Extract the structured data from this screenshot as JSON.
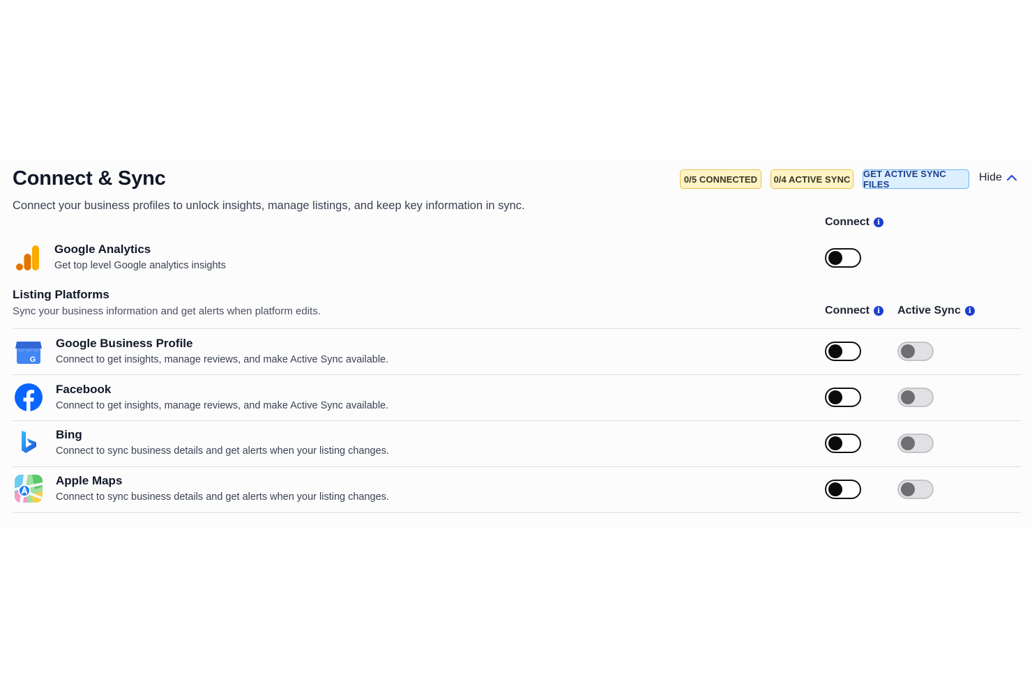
{
  "header": {
    "title": "Connect & Sync",
    "subtitle": "Connect your business profiles to unlock insights, manage listings, and keep key information in sync.",
    "badges": {
      "connected": "0/5 CONNECTED",
      "active_sync": "0/4 ACTIVE SYNC",
      "files": "GET ACTIVE SYNC FILES"
    },
    "hide_label": "Hide"
  },
  "analytics": {
    "column_connect": "Connect",
    "name": "Google Analytics",
    "description": "Get top level Google analytics insights",
    "connected": false
  },
  "listing": {
    "title": "Listing Platforms",
    "subtitle": "Sync your business information and get alerts when platform edits.",
    "column_connect": "Connect",
    "column_active_sync": "Active Sync",
    "platforms": [
      {
        "name": "Google Business Profile",
        "description": "Connect to get insights, manage reviews, and make Active Sync available.",
        "icon": "google-business-profile-icon",
        "connected": false,
        "active_sync": false
      },
      {
        "name": "Facebook",
        "description": "Connect to get insights, manage reviews, and make Active Sync available.",
        "icon": "facebook-icon",
        "connected": false,
        "active_sync": false
      },
      {
        "name": "Bing",
        "description": "Connect to sync business details and get alerts when your listing changes.",
        "icon": "bing-icon",
        "connected": false,
        "active_sync": false
      },
      {
        "name": "Apple Maps",
        "description": "Connect to sync business details and get alerts when your listing changes.",
        "icon": "apple-maps-icon",
        "connected": false,
        "active_sync": false
      }
    ]
  },
  "colors": {
    "badge_yellow_bg": "#fdf3c5",
    "badge_blue_bg": "#dcefff",
    "info_icon": "#1d3fd1",
    "toggle_off": "#0b0b0b",
    "toggle_disabled": "#e1e1e4"
  }
}
